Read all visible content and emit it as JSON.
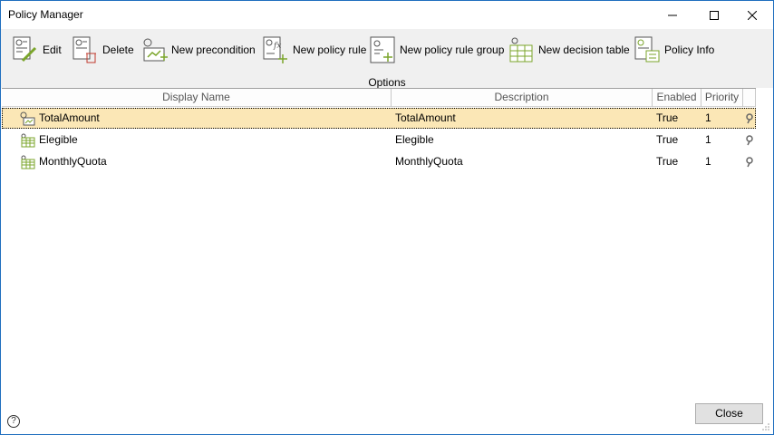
{
  "window": {
    "title": "Policy Manager"
  },
  "titlebar_buttons": {
    "minimize": "─",
    "maximize": "☐",
    "close": "✕"
  },
  "toolbar": {
    "group_label": "Options",
    "buttons": [
      {
        "label": "Edit",
        "icon": "edit-icon"
      },
      {
        "label": "Delete",
        "icon": "delete-icon"
      },
      {
        "label": "New precondition",
        "icon": "new-precondition-icon"
      },
      {
        "label": "New policy rule",
        "icon": "new-policy-rule-icon"
      },
      {
        "label": "New policy rule group",
        "icon": "new-policy-rule-group-icon"
      },
      {
        "label": "New decision table",
        "icon": "new-decision-table-icon"
      },
      {
        "label": "Policy Info",
        "icon": "policy-info-icon"
      }
    ]
  },
  "table": {
    "columns": [
      "Display Name",
      "Description",
      "Enabled",
      "Priority"
    ],
    "rows": [
      {
        "name": "TotalAmount",
        "description": "TotalAmount",
        "enabled": "True",
        "priority": "1",
        "icon": "precondition-icon",
        "selected": true
      },
      {
        "name": "Elegible",
        "description": "Elegible",
        "enabled": "True",
        "priority": "1",
        "icon": "decision-table-icon",
        "selected": false
      },
      {
        "name": "MonthlyQuota",
        "description": "MonthlyQuota",
        "enabled": "True",
        "priority": "1",
        "icon": "decision-table-icon",
        "selected": false
      }
    ]
  },
  "footer": {
    "help": "?",
    "close_label": "Close"
  }
}
